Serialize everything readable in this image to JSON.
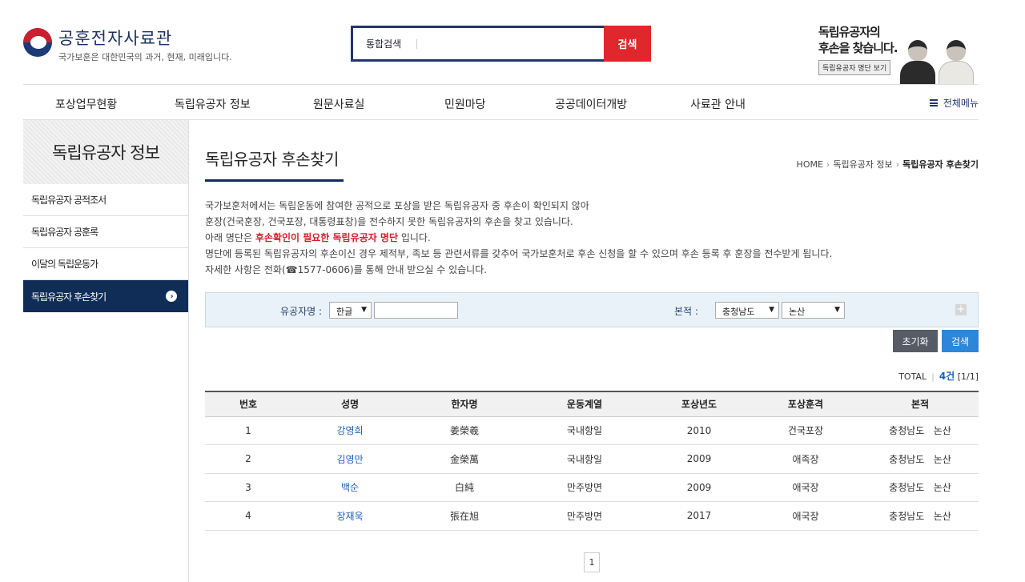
{
  "header": {
    "site_title": "공훈전자사료관",
    "slogan": "국가보훈은 대한민국의 과거, 현재, 미래입니다.",
    "search_label": "통합검색",
    "search_value": "",
    "search_button": "검색",
    "promo_title_line1": "독립유공자의",
    "promo_title_line2": "후손을 찾습니다.",
    "promo_button": "독립유공자 명단 보기"
  },
  "gnb": {
    "items": [
      "포상업무현황",
      "독립유공자 정보",
      "원문사료실",
      "민원마당",
      "공공데이터개방",
      "사료관 안내"
    ],
    "all_menu": "전체메뉴"
  },
  "side": {
    "title": "독립유공자 정보",
    "items": [
      "독립유공자 공적조서",
      "독립유공자 공훈록",
      "이달의 독립운동가",
      "독립유공자 후손찾기"
    ]
  },
  "page": {
    "title": "독립유공자 후손찾기",
    "breadcrumb": [
      "HOME",
      "독립유공자 정보",
      "독립유공자 후손찾기"
    ]
  },
  "desc": {
    "line1": "국가보훈처에서는 독립운동에 참여한 공적으로 포상을 받은 독립유공자 중 후손이 확인되지 않아",
    "line2": "훈장(건국훈장, 건국포장, 대통령표창)을 전수하지 못한 독립유공자의 후손을 찾고 있습니다.",
    "line3_pre": "아래 명단은",
    "line3_red": "후손확인이 필요한 독립유공자 명단",
    "line3_post": "입니다.",
    "line4": "명단에 등록된 독립유공자의 후손이신 경우 제적부, 족보 등 관련서류를 갖추어 국가보훈처로 후손 신청을 할 수 있으며 후손 등록 후 훈장을 전수받게 됩니다.",
    "line5": "자세한 사항은 전화(☎1577-0606)를 통해 안내 받으실 수 있습니다."
  },
  "search": {
    "name_label": "유공자명 :",
    "name_type": "한글",
    "name_value": "",
    "origin_label": "본적 :",
    "province": "충청남도",
    "city": "논산",
    "reset_button": "초기화",
    "search_button": "검색"
  },
  "total": {
    "label": "TOTAL",
    "count": "4건",
    "pages": "[1/1]"
  },
  "table": {
    "headers": [
      "번호",
      "성명",
      "한자명",
      "운동계열",
      "포상년도",
      "포상훈격",
      "본적"
    ],
    "rows": [
      [
        "1",
        "강영희",
        "姜榮羲",
        "국내항일",
        "2010",
        "건국포장",
        "충청남도   논산"
      ],
      [
        "2",
        "김영만",
        "金榮萬",
        "국내항일",
        "2009",
        "애족장",
        "충청남도   논산"
      ],
      [
        "3",
        "백순",
        "白純",
        "만주방면",
        "2009",
        "애국장",
        "충청남도   논산"
      ],
      [
        "4",
        "장재욱",
        "張在旭",
        "만주방면",
        "2017",
        "애국장",
        "충청남도   논산"
      ]
    ]
  },
  "pager": {
    "current": "1"
  }
}
